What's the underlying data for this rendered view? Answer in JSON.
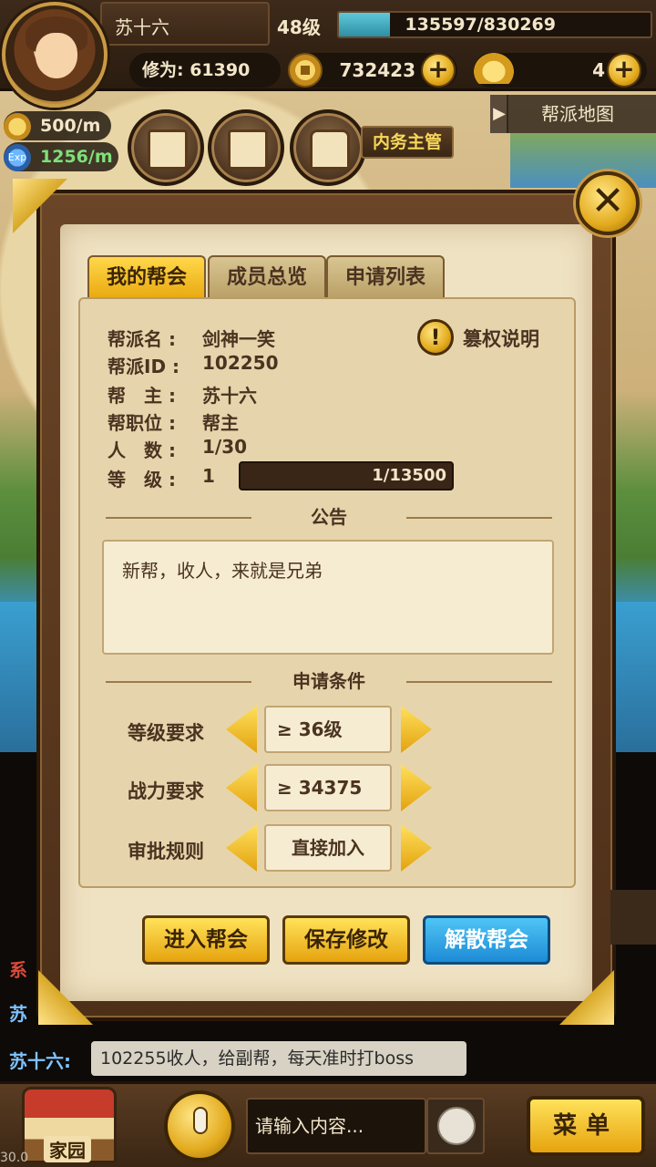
{
  "player": {
    "name": "苏十六",
    "level": "48级",
    "exp_text": "135597/830269",
    "exp_fraction": 0.163,
    "cultivation": "修为: 61390",
    "coins": "732423",
    "ingots": "4",
    "gold_rate": "500/m",
    "exp_rate": "1256/m",
    "exp_rate_icon": "Exp"
  },
  "hud": {
    "steward_label": "内务主管",
    "map_label": "帮派地图"
  },
  "tabs": [
    {
      "label": "我的帮会",
      "active": true
    },
    {
      "label": "成员总览",
      "active": false
    },
    {
      "label": "申请列表",
      "active": false
    }
  ],
  "guild": {
    "rows": [
      {
        "label": "帮派名 :",
        "value": "剑神一笑"
      },
      {
        "label": "帮派ID :",
        "value": "102250"
      },
      {
        "label": "帮　主 :",
        "value": "苏十六"
      },
      {
        "label": "帮职位 :",
        "value": "帮主"
      },
      {
        "label": "人　数 :",
        "value": "1/30"
      },
      {
        "label": "等　级 :",
        "value": "1"
      }
    ],
    "exp_text": "1/13500",
    "usurp_label": "篡权说明"
  },
  "notice": {
    "header": "公告",
    "text": "新帮，收人，来就是兄弟"
  },
  "conditions": {
    "header": "申请条件",
    "items": [
      {
        "label": "等级要求",
        "value": "≥ 36级"
      },
      {
        "label": "战力要求",
        "value": "≥ 34375"
      },
      {
        "label": "审批规则",
        "value": "直接加入"
      }
    ]
  },
  "actions": {
    "enter": "进入帮会",
    "save": "保存修改",
    "disband": "解散帮会"
  },
  "chat": {
    "partial_lines": [
      "系",
      "苏"
    ],
    "speaker": "苏十六:",
    "message": "102255收人，给副帮，每天准时打boss",
    "input_placeholder": "请输入内容..."
  },
  "bottom": {
    "home_label": "家园",
    "menu_label": "菜单",
    "fps": "30.0"
  },
  "colors": {
    "accent_gold": "#e6a30e",
    "blue_button": "#1d8bd6",
    "exp_rate_green": "#7fe07a",
    "chat_name_blue": "#7fc3ff"
  }
}
